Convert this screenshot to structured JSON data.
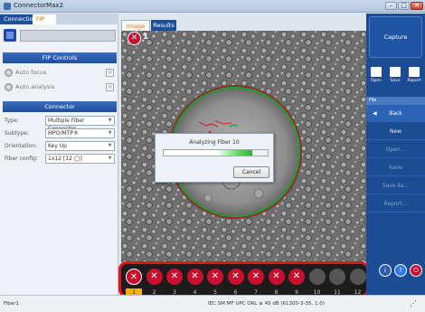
{
  "window": {
    "title": "ConnectorMax2"
  },
  "left_tabs": {
    "connection": "Connection",
    "fip": "FIP"
  },
  "fip_controls": {
    "header": "FIP Controls",
    "auto_focus": "Auto focus",
    "auto_analysis": "Auto analysis"
  },
  "connector": {
    "header": "Connector",
    "type_label": "Type:",
    "type_value": "Multiple Fiber Connector",
    "subtype_label": "Subtype:",
    "subtype_value": "MPO/MTP®",
    "orientation_label": "Orientation:",
    "orientation_value": "Key Up",
    "fiber_config_label": "Fiber config:",
    "fiber_config_value": "1x12 [12 ◯]"
  },
  "image_tabs": {
    "image": "Image",
    "results": "Results"
  },
  "current_fiber": {
    "number": "1"
  },
  "dialog": {
    "message": "Analyzing Fiber  10",
    "cancel": "Cancel",
    "progress": 0.85
  },
  "fibers": [
    {
      "num": "1",
      "status": "fail",
      "selected": true
    },
    {
      "num": "2",
      "status": "fail"
    },
    {
      "num": "3",
      "status": "fail"
    },
    {
      "num": "4",
      "status": "fail"
    },
    {
      "num": "5",
      "status": "fail"
    },
    {
      "num": "6",
      "status": "fail"
    },
    {
      "num": "7",
      "status": "fail"
    },
    {
      "num": "8",
      "status": "fail"
    },
    {
      "num": "9",
      "status": "fail"
    },
    {
      "num": "10",
      "status": "pending"
    },
    {
      "num": "11",
      "status": "pending"
    },
    {
      "num": "12",
      "status": "pending"
    }
  ],
  "sidebar": {
    "capture": "Capture",
    "open": "Open",
    "save": "Save",
    "report": "Report",
    "file_header": "File",
    "back": "Back",
    "new": "New",
    "open_menu": "Open...",
    "save_menu": "Save",
    "save_as": "Save As...",
    "report_menu": "Report...",
    "arrow": "◀"
  },
  "status": {
    "left": "Fiber1",
    "center": "IEC SM MF UPC ORL ≥ 45 dB (61300-3-35, 1.0)"
  },
  "colors": {
    "fail": "#c8102e",
    "accent": "#1e4f9a",
    "highlight": "#e1151a",
    "selected": "#f0b400"
  }
}
